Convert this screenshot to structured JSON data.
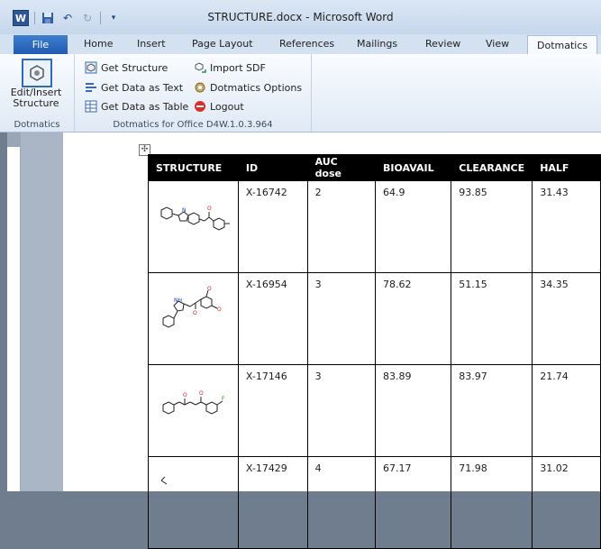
{
  "window": {
    "title": "STRUCTURE.docx - Microsoft Word",
    "app_icon": "W"
  },
  "qat": {
    "icons": [
      "word-icon",
      "save-icon",
      "undo-icon",
      "redo-icon",
      "customize-icon"
    ]
  },
  "tabs": [
    "File",
    "Home",
    "Insert",
    "Page Layout",
    "References",
    "Mailings",
    "Review",
    "View",
    "Dotmatics"
  ],
  "active_tab": "Dotmatics",
  "ribbon": {
    "group1": {
      "button_line1": "Edit/Insert",
      "button_line2": "Structure",
      "label": "Dotmatics"
    },
    "group2": {
      "label": "Dotmatics for Office D4W.1.0.3.964",
      "get_structure": "Get Structure",
      "get_data_text": "Get Data as Text",
      "get_data_table": "Get Data as Table",
      "import_sdf": "Import SDF",
      "options": "Dotmatics Options",
      "logout": "Logout"
    }
  },
  "table": {
    "headers": [
      "STRUCTURE",
      "ID",
      "AUC dose",
      "BIOAVAIL",
      "CLEARANCE",
      "HALF"
    ],
    "rows": [
      {
        "id": "X-16742",
        "auc": "2",
        "bio": "64.9",
        "clear": "93.85",
        "half": "31.43"
      },
      {
        "id": "X-16954",
        "auc": "3",
        "bio": "78.62",
        "clear": "51.15",
        "half": "34.35"
      },
      {
        "id": "X-17146",
        "auc": "3",
        "bio": "83.89",
        "clear": "83.97",
        "half": "21.74"
      },
      {
        "id": "X-17429",
        "auc": "4",
        "bio": "67.17",
        "clear": "71.98",
        "half": "31.02"
      }
    ]
  }
}
